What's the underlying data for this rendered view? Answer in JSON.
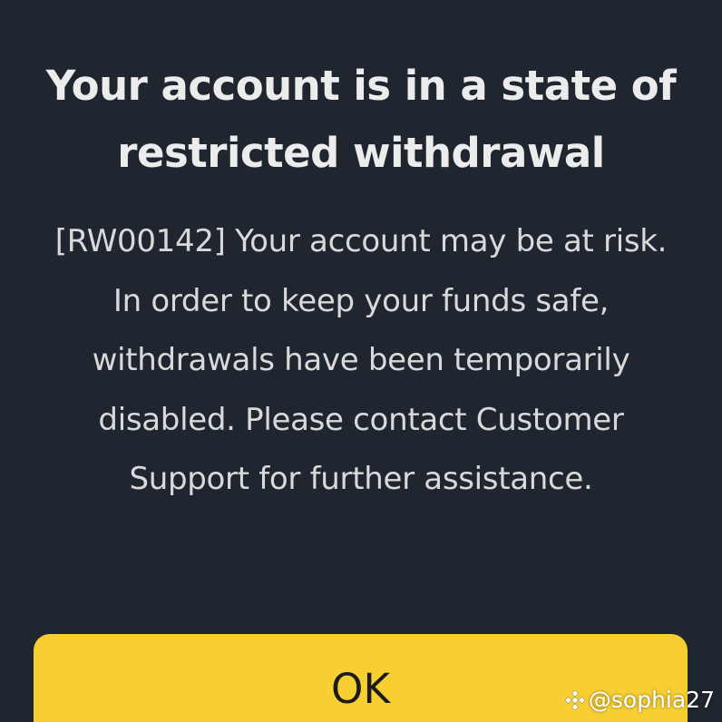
{
  "dialog": {
    "title": "Your account is in a state of restricted withdrawal",
    "message": "[RW00142] Your account may be at risk. In order to keep your funds safe, withdrawals have been temporarily disabled. Please contact Customer Support for further assistance.",
    "ok_label": "OK"
  },
  "watermark": {
    "icon": "binance-logo-icon",
    "handle": "@sophia27"
  },
  "colors": {
    "background": "#1f2630",
    "title": "#ececec",
    "message": "#d9d9d9",
    "button": "#f7cf33",
    "button_text": "#1b1b1b"
  }
}
